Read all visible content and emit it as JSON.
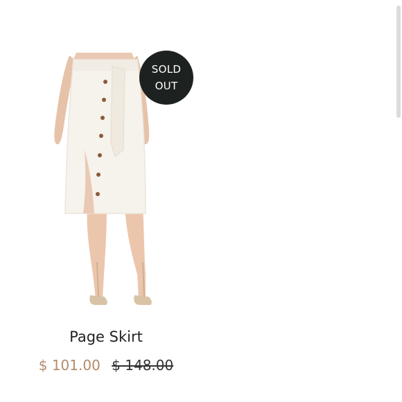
{
  "product": {
    "name": "Page Skirt",
    "badge": {
      "line1": "SOLD",
      "line2": "OUT"
    },
    "price": {
      "sale": "$ 101.00",
      "original": "$ 148.00"
    },
    "image": {
      "icon": "skirt-product-photo"
    }
  },
  "colors": {
    "sale_price": "#b48a6a",
    "badge_bg": "#1d2120"
  }
}
